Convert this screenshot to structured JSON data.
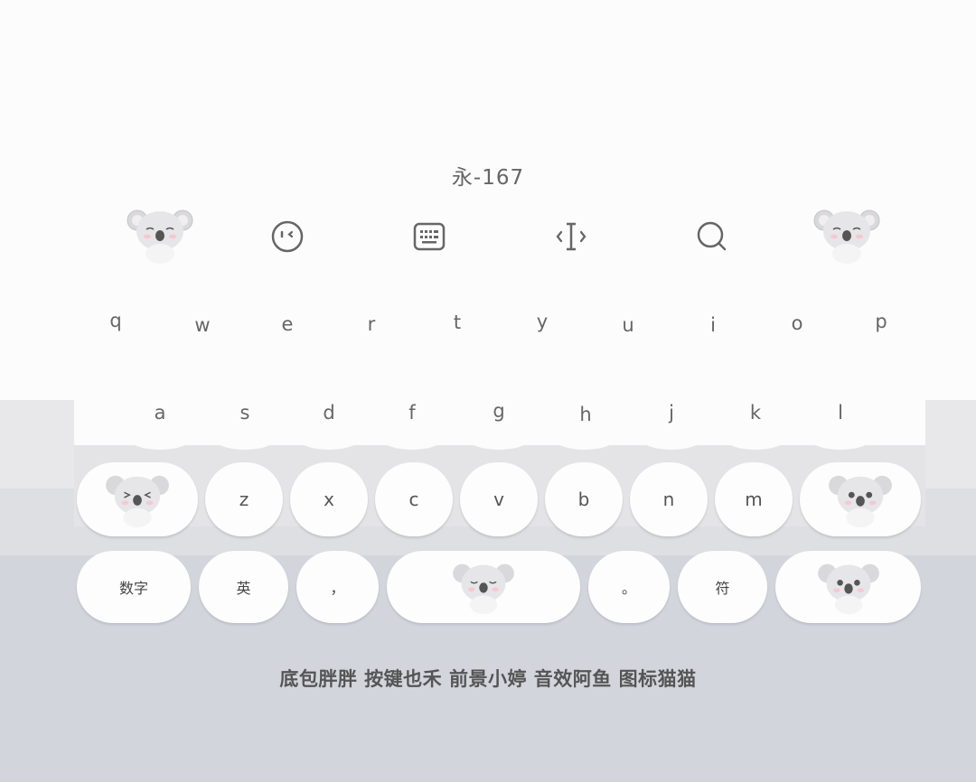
{
  "keyboard": {
    "title": "永-167",
    "toolbar": {
      "emoji_icon": "emoji-face-icon",
      "keyboard_icon": "keyboard-icon",
      "cursor_icon": "text-cursor-icon",
      "search_icon": "search-icon"
    },
    "row1": [
      "q",
      "w",
      "e",
      "r",
      "t",
      "y",
      "u",
      "i",
      "o",
      "p"
    ],
    "row2": [
      "a",
      "s",
      "d",
      "f",
      "g",
      "h",
      "j",
      "k",
      "l"
    ],
    "row3": [
      "z",
      "x",
      "c",
      "v",
      "b",
      "n",
      "m"
    ],
    "bottom": {
      "numbers_label": "数字",
      "lang_label": "英",
      "comma_label": "，",
      "period_label": "。",
      "symbols_label": "符"
    }
  },
  "footer_credits": "底包胖胖 按键也禾 前景小婷 音效阿鱼 图标猫猫",
  "colors": {
    "background": "#d3d5dd",
    "key": "#fdfdfd",
    "text": "#666666"
  }
}
